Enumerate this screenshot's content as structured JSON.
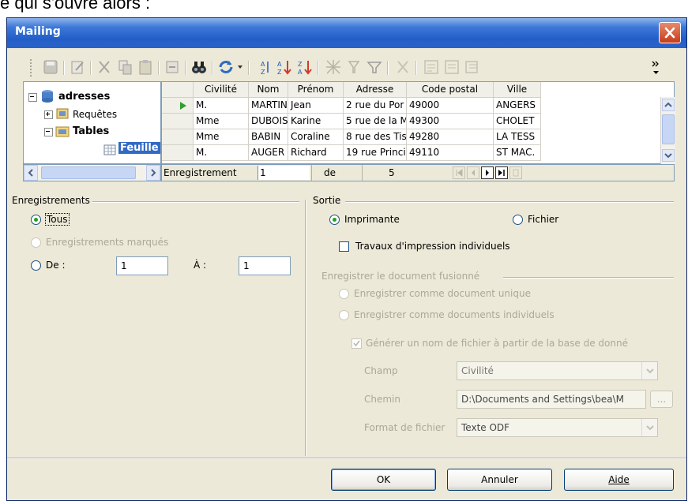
{
  "top_text": "e qui s'ouvre alors :",
  "window": {
    "title": "Mailing"
  },
  "tree": {
    "root": "adresses",
    "queries": "Requêtes",
    "tables": "Tables",
    "sheet": "Feuille"
  },
  "grid": {
    "headers": [
      "Civilité",
      "Nom",
      "Prénom",
      "Adresse",
      "Code postal",
      "Ville"
    ],
    "rows": [
      [
        "M.",
        "MARTIN",
        "Jean",
        "2 rue du Por",
        "49000",
        "ANGERS"
      ],
      [
        "Mme",
        "DUBOIS",
        "Karine",
        "5 rue de la M",
        "49300",
        "CHOLET"
      ],
      [
        "Mme",
        "BABIN",
        "Coraline",
        "8 rue des Tis",
        "49280",
        "LA TESS"
      ],
      [
        "M.",
        "AUGER",
        "Richard",
        "19 rue Princi",
        "49110",
        "ST MAC."
      ]
    ]
  },
  "navigation": {
    "label": "Enregistrement",
    "current": "1",
    "of_label": "de",
    "total": "5"
  },
  "records": {
    "title": "Enregistrements",
    "all": "Tous",
    "marked": "Enregistrements marqués",
    "from_label": "De :",
    "from_value": "1",
    "to_label": "À :",
    "to_value": "1"
  },
  "output": {
    "title": "Sortie",
    "printer": "Imprimante",
    "file": "Fichier",
    "individual_jobs": "Travaux d'impression individuels",
    "save_title": "Enregistrer le document fusionné",
    "save_single": "Enregistrer comme document unique",
    "save_individual": "Enregistrer comme documents individuels",
    "generate_name": "Générer un nom de fichier à partir de la base de donné",
    "field_label": "Champ",
    "field_value": "Civilité",
    "path_label": "Chemin",
    "path_value": "D:\\Documents and Settings\\bea\\M",
    "browse": "...",
    "format_label": "Format de fichier",
    "format_value": "Texte ODF"
  },
  "buttons": {
    "ok": "OK",
    "cancel": "Annuler",
    "help": "Aide"
  },
  "colors": {
    "title_bar": "#2a63c9",
    "dialog_bg": "#ece9d8",
    "radio_dot": "#21a121",
    "close": "#c63c1a"
  }
}
